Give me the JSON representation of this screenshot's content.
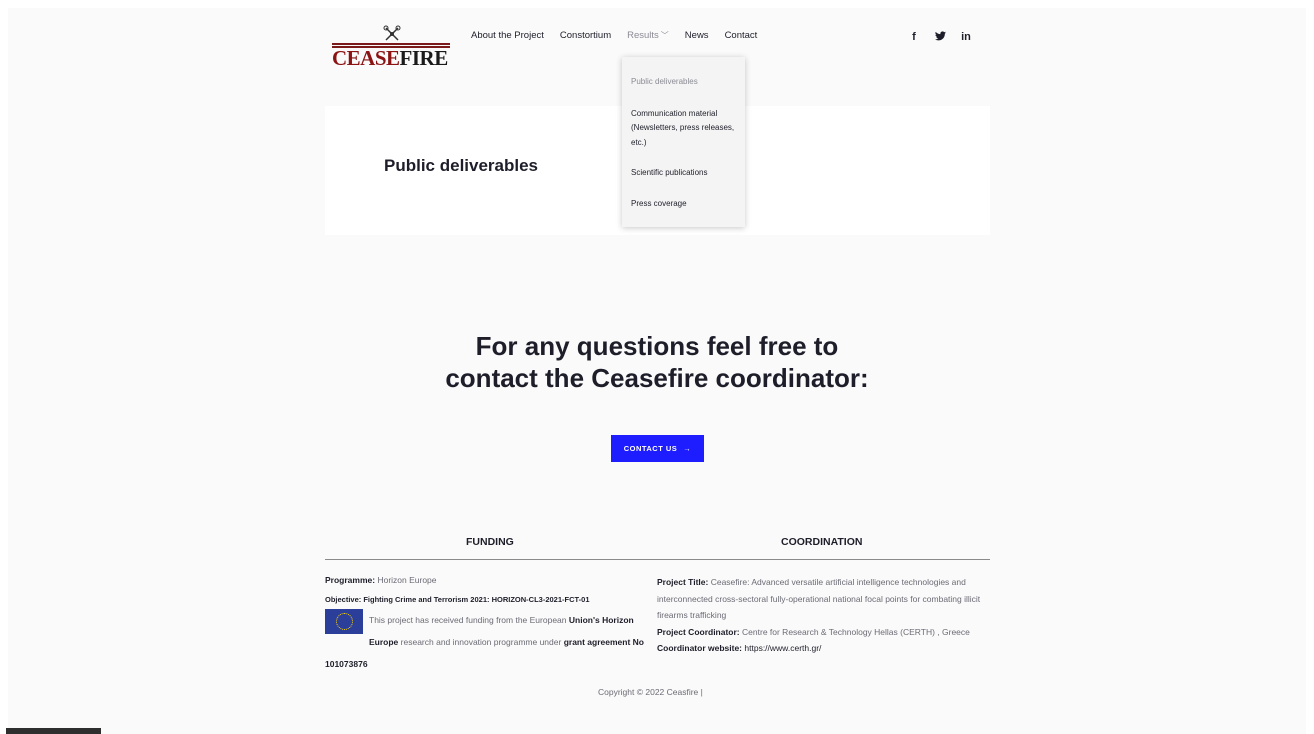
{
  "brand": {
    "logo_text_red": "CEASE",
    "logo_text_dark": "FIRE"
  },
  "nav": {
    "items": [
      {
        "label": "About the Project"
      },
      {
        "label": "Constortium"
      },
      {
        "label": "Results"
      },
      {
        "label": "News"
      },
      {
        "label": "Contact"
      }
    ]
  },
  "social": {
    "facebook": "f",
    "twitter": "𝕥",
    "linkedin": "in"
  },
  "dropdown": {
    "items": [
      {
        "label": "Public deliverables"
      },
      {
        "label": "Communication material (Newsletters, press releases, etc.)"
      },
      {
        "label": "Scientific publications"
      },
      {
        "label": "Press coverage"
      }
    ]
  },
  "page": {
    "title": "Public deliverables"
  },
  "cta": {
    "heading": "For any questions feel free to contact the Ceasefire coordinator:",
    "button_label": "CONTACT US",
    "button_arrow": "→"
  },
  "footer": {
    "funding_heading": "FUNDING",
    "coordination_heading": "COORDINATION",
    "programme_label": "Programme:",
    "programme_value": "Horizon Europe",
    "objective": "Objective: Fighting Crime and Terrorism 2021: HORIZON-CL3-2021-FCT-01",
    "funding_text_1": "This project has received funding from the European",
    "funding_union": "Union's Horizon Europe",
    "funding_text_2": "research and innovation programme under",
    "funding_grant": "grant agreement No 101073876",
    "project_title_label": "Project Title:",
    "project_title_value": "Ceasefire: Advanced versatile artificial intelligence technologies and interconnected cross-sectoral fully-operational national focal points for combating illicit firearms trafficking",
    "coordinator_label": "Project Coordinator:",
    "coordinator_value": "Centre for Research & Technology Hellas (CERTH) , Greece",
    "website_label": "Coordinator website:",
    "website_value": "https://www.certh.gr/",
    "copyright": "Copyright © 2022 Ceasfire |"
  },
  "colors": {
    "accent": "#1d1dff",
    "brand_red": "#8b1313",
    "text": "#1e1e2a",
    "muted": "#8b8b95",
    "eu_blue": "#2b3e99"
  },
  "icons": {
    "chevron": "chevron-down-icon",
    "arrow": "arrow-right-icon",
    "drone": "drone-icon"
  }
}
